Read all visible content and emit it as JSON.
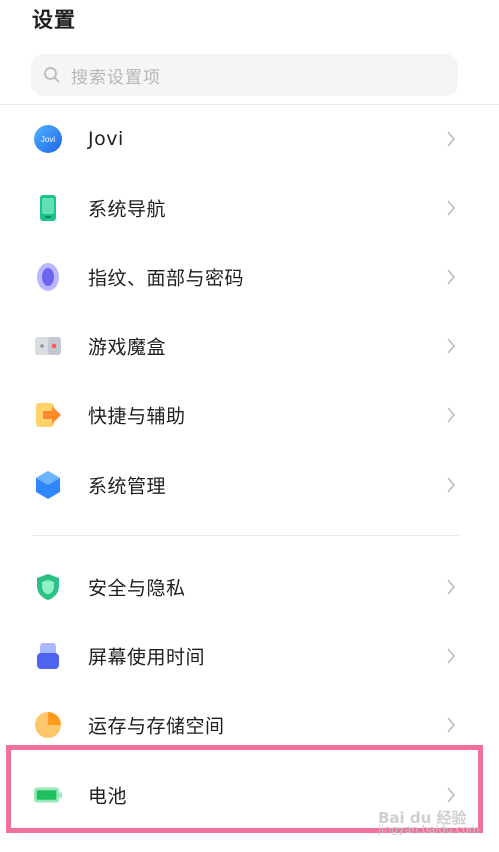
{
  "header": {
    "title": "设置"
  },
  "search": {
    "placeholder": "搜索设置项"
  },
  "items": [
    {
      "label": "Jovi",
      "icon": "jovi-icon",
      "jovi_badge": "Jovi"
    },
    {
      "label": "系统导航",
      "icon": "phone-navigation-icon"
    },
    {
      "label": "指纹、面部与密码",
      "icon": "fingerprint-icon"
    },
    {
      "label": "游戏魔盒",
      "icon": "game-box-icon"
    },
    {
      "label": "快捷与辅助",
      "icon": "shortcut-arrow-icon"
    },
    {
      "label": "系统管理",
      "icon": "system-management-hexagon-icon"
    },
    {
      "label": "安全与隐私",
      "icon": "shield-icon"
    },
    {
      "label": "屏幕使用时间",
      "icon": "screen-time-icon"
    },
    {
      "label": "运存与存储空间",
      "icon": "storage-pie-icon"
    },
    {
      "label": "电池",
      "icon": "battery-icon"
    }
  ],
  "highlight_color": "#f0709e",
  "watermark": {
    "line1": "Bai du 经验",
    "line2": "jingyan.baidu.com"
  }
}
